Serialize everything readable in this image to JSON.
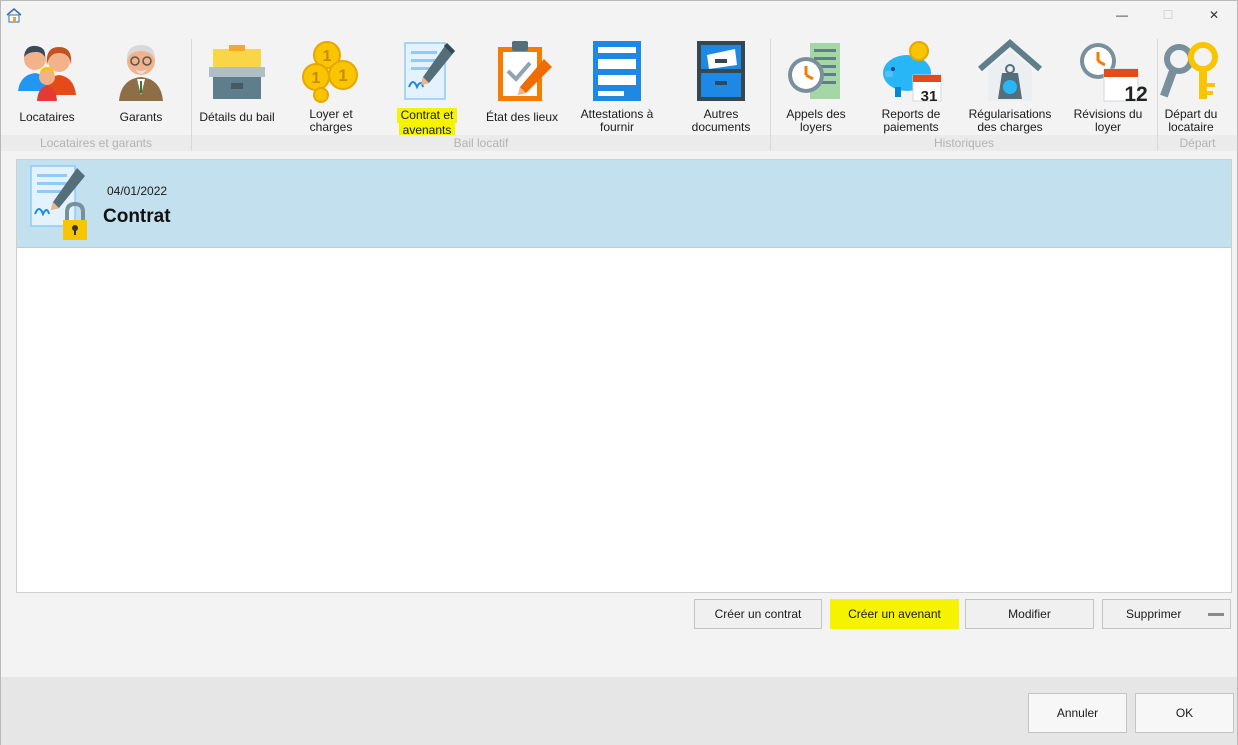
{
  "window": {
    "minimize_glyph": "—",
    "maximize_glyph": "☐",
    "close_glyph": "✕"
  },
  "ribbon": {
    "items": [
      {
        "label": "Locataires",
        "icon": "tenants-icon"
      },
      {
        "label": "Garants",
        "icon": "guarantor-icon"
      },
      {
        "label": "Détails du bail",
        "icon": "lease-box-icon"
      },
      {
        "label_l1": "Loyer et",
        "label_l2": "charges",
        "icon": "coins-icon"
      },
      {
        "label_l1": "Contrat et",
        "label_l2": "avenants",
        "icon": "contract-icon",
        "selected": true
      },
      {
        "label": "État des lieux",
        "icon": "checklist-icon"
      },
      {
        "label_l1": "Attestations à",
        "label_l2": "fournir",
        "icon": "certificates-icon"
      },
      {
        "label_l1": "Autres",
        "label_l2": "documents",
        "icon": "filing-cabinet-icon"
      },
      {
        "label_l1": "Appels des",
        "label_l2": "loyers",
        "icon": "rent-call-clock-icon"
      },
      {
        "label_l1": "Reports de",
        "label_l2": "paiements",
        "icon": "piggy-calendar-icon"
      },
      {
        "label_l1": "Régularisations",
        "label_l2": "des charges",
        "icon": "house-weight-icon"
      },
      {
        "label_l1": "Révisions du",
        "label_l2": "loyer",
        "icon": "clock-calendar-icon"
      },
      {
        "label_l1": "Départ du",
        "label_l2": "locataire",
        "icon": "keys-icon"
      }
    ],
    "groups": {
      "g1": "Locataires et garants",
      "g2": "Bail locatif",
      "g3": "Historiques",
      "g4": "Départ"
    },
    "calendar_day_1": "31",
    "calendar_day_2": "12"
  },
  "list": {
    "items": [
      {
        "date": "04/01/2022",
        "title": "Contrat",
        "icon": "locked-contract-icon"
      }
    ]
  },
  "actions": {
    "create_contract": "Créer un contrat",
    "create_amendment": "Créer un avenant",
    "modify": "Modifier",
    "delete": "Supprimer"
  },
  "footer": {
    "cancel": "Annuler",
    "ok": "OK"
  },
  "colors": {
    "highlight": "#f5f300",
    "selected_row": "#c3e0ef",
    "accent_blue": "#2196f3",
    "accent_orange": "#f57c00"
  }
}
